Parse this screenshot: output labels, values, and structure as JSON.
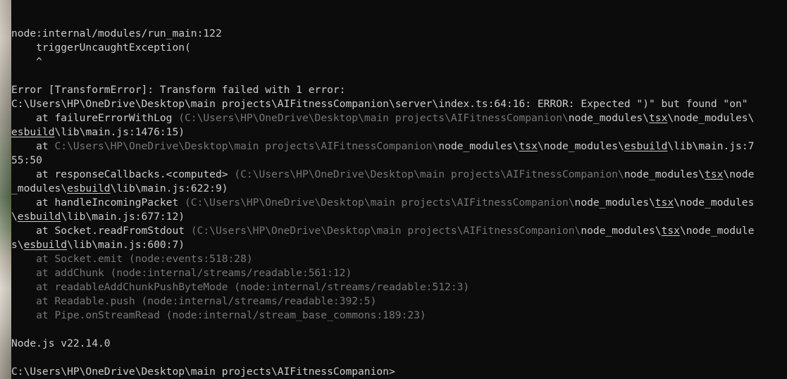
{
  "terminal": {
    "colors": {
      "background": "#0c0c0c",
      "text": "#cccccc",
      "dim_text": "#767676"
    },
    "lines": [
      {
        "id": "l1",
        "segments": [
          {
            "t": "node:internal/modules/run_main:122"
          }
        ]
      },
      {
        "id": "l2",
        "segments": [
          {
            "t": "    triggerUncaughtException("
          }
        ]
      },
      {
        "id": "l3",
        "segments": [
          {
            "t": "    ^"
          }
        ]
      },
      {
        "id": "l4",
        "segments": [
          {
            "t": ""
          }
        ]
      },
      {
        "id": "l5",
        "segments": [
          {
            "t": "Error [TransformError]: Transform failed with 1 error:"
          }
        ]
      },
      {
        "id": "l6",
        "segments": [
          {
            "t": "C:\\Users\\HP\\OneDrive\\Desktop\\main projects\\AIFitnessCompanion\\server\\index.ts:64:16: ERROR: Expected \")\" but found \"on\""
          }
        ]
      },
      {
        "id": "l7",
        "segments": [
          {
            "t": "    at failureErrorWithLog "
          },
          {
            "t": "(C:\\Users\\HP\\OneDrive\\Desktop\\main projects\\AIFitnessCompanion\\",
            "s": "dim"
          },
          {
            "t": "node_modules\\"
          },
          {
            "t": "tsx",
            "s": "u"
          },
          {
            "t": "\\node_modules\\"
          }
        ]
      },
      {
        "id": "l8",
        "segments": [
          {
            "t": "esbuild",
            "s": "u"
          },
          {
            "t": "\\lib\\main.js:1476:15)"
          }
        ]
      },
      {
        "id": "l9",
        "segments": [
          {
            "t": "    at "
          },
          {
            "t": "C:\\Users\\HP\\OneDrive\\Desktop\\main projects\\AIFitnessCompanion\\",
            "s": "dim"
          },
          {
            "t": "node_modules\\"
          },
          {
            "t": "tsx",
            "s": "u"
          },
          {
            "t": "\\node_modules\\"
          },
          {
            "t": "esbuild",
            "s": "u"
          },
          {
            "t": "\\lib\\main.js:7"
          }
        ]
      },
      {
        "id": "l10",
        "segments": [
          {
            "t": "55:50"
          }
        ]
      },
      {
        "id": "l11",
        "segments": [
          {
            "t": "    at responseCallbacks.<computed> "
          },
          {
            "t": "(C:\\Users\\HP\\OneDrive\\Desktop\\main projects\\AIFitnessCompanion\\",
            "s": "dim"
          },
          {
            "t": "node_modules\\"
          },
          {
            "t": "tsx",
            "s": "u"
          },
          {
            "t": "\\node"
          }
        ]
      },
      {
        "id": "l12",
        "segments": [
          {
            "t": "_modules\\"
          },
          {
            "t": "esbuild",
            "s": "u"
          },
          {
            "t": "\\lib\\main.js:622:9)"
          }
        ]
      },
      {
        "id": "l13",
        "segments": [
          {
            "t": "    at handleIncomingPacket "
          },
          {
            "t": "(C:\\Users\\HP\\OneDrive\\Desktop\\main projects\\AIFitnessCompanion\\",
            "s": "dim"
          },
          {
            "t": "node_modules\\"
          },
          {
            "t": "tsx",
            "s": "u"
          },
          {
            "t": "\\node_modules"
          }
        ]
      },
      {
        "id": "l14",
        "segments": [
          {
            "t": "\\"
          },
          {
            "t": "esbuild",
            "s": "u"
          },
          {
            "t": "\\lib\\main.js:677:12)"
          }
        ]
      },
      {
        "id": "l15",
        "segments": [
          {
            "t": "    at Socket.readFromStdout "
          },
          {
            "t": "(C:\\Users\\HP\\OneDrive\\Desktop\\main projects\\AIFitnessCompanion\\",
            "s": "dim"
          },
          {
            "t": "node_modules\\"
          },
          {
            "t": "tsx",
            "s": "u"
          },
          {
            "t": "\\node_module"
          }
        ]
      },
      {
        "id": "l16",
        "segments": [
          {
            "t": "s\\"
          },
          {
            "t": "esbuild",
            "s": "u"
          },
          {
            "t": "\\lib\\main.js:600:7)"
          }
        ]
      },
      {
        "id": "l17",
        "segments": [
          {
            "t": "    at Socket.emit (node:events:518:28)",
            "s": "dim"
          }
        ]
      },
      {
        "id": "l18",
        "segments": [
          {
            "t": "    at addChunk (node:internal/streams/readable:561:12)",
            "s": "dim"
          }
        ]
      },
      {
        "id": "l19",
        "segments": [
          {
            "t": "    at readableAddChunkPushByteMode (node:internal/streams/readable:512:3)",
            "s": "dim"
          }
        ]
      },
      {
        "id": "l20",
        "segments": [
          {
            "t": "    at Readable.push (node:internal/streams/readable:392:5)",
            "s": "dim"
          }
        ]
      },
      {
        "id": "l21",
        "segments": [
          {
            "t": "    at Pipe.onStreamRead (node:internal/stream_base_commons:189:23)",
            "s": "dim"
          }
        ]
      },
      {
        "id": "l22",
        "segments": [
          {
            "t": ""
          }
        ]
      },
      {
        "id": "l23",
        "segments": [
          {
            "t": "Node.js v22.14.0"
          }
        ]
      },
      {
        "id": "l24",
        "segments": [
          {
            "t": ""
          }
        ]
      },
      {
        "id": "l25",
        "segments": [
          {
            "t": "C:\\Users\\HP\\OneDrive\\Desktop\\main projects\\AIFitnessCompanion>"
          }
        ]
      }
    ]
  }
}
